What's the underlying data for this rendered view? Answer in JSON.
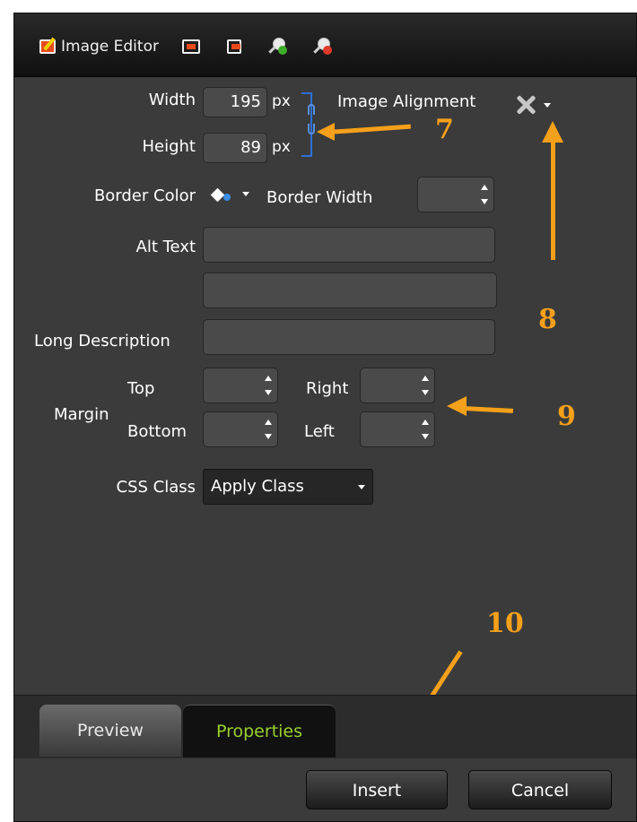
{
  "toolbar": {
    "title": "Image Editor",
    "icons": [
      "image-edit-icon",
      "fit-frame-icon",
      "actual-size-icon",
      "zoom-in-icon",
      "zoom-out-icon"
    ]
  },
  "dimensions": {
    "width_label": "Width",
    "width_value": "195",
    "height_label": "Height",
    "height_value": "89",
    "unit": "px"
  },
  "alignment": {
    "label": "Image Alignment"
  },
  "border": {
    "color_label": "Border Color",
    "width_label": "Border Width",
    "width_value": ""
  },
  "alt_text": {
    "label": "Alt Text",
    "value": ""
  },
  "title_field": {
    "value": ""
  },
  "long_description": {
    "label": "Long Description",
    "value": ""
  },
  "margin": {
    "label": "Margin",
    "top_label": "Top",
    "right_label": "Right",
    "bottom_label": "Bottom",
    "left_label": "Left",
    "top": "",
    "right": "",
    "bottom": "",
    "left": ""
  },
  "css_class": {
    "label": "CSS Class",
    "selected": "Apply Class"
  },
  "tabs": [
    {
      "label": "Preview",
      "active": false
    },
    {
      "label": "Properties",
      "active": true
    }
  ],
  "buttons": {
    "insert": "Insert",
    "cancel": "Cancel"
  },
  "callouts": {
    "c7": "7",
    "c8": "8",
    "c9": "9",
    "c10": "10"
  },
  "colors": {
    "accent": "#f5a01a",
    "active_tab_text": "#9bd12e",
    "panel_bg": "#3b3b3b"
  }
}
